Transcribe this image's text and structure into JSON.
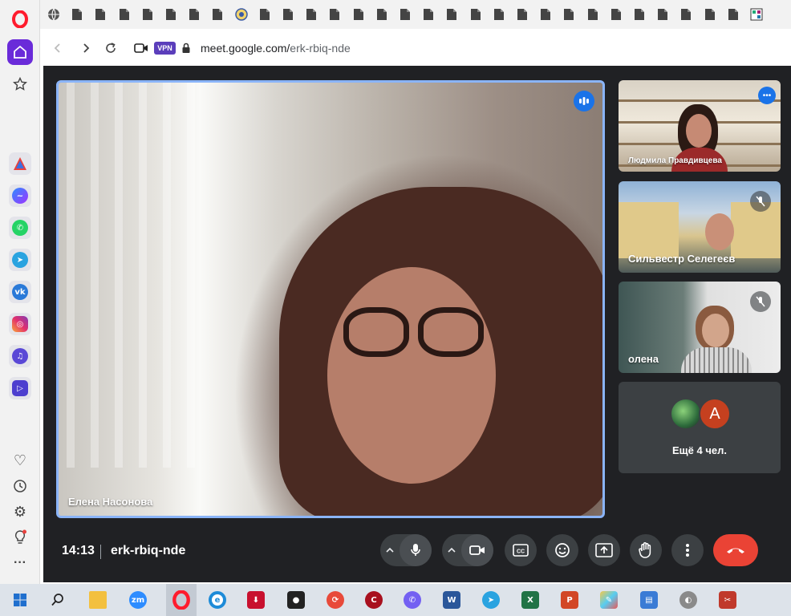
{
  "browser": {
    "url_host": "meet.google.com/",
    "url_path": "erk-rbiq-nde",
    "vpn_badge": "VPN",
    "tab_count": 31
  },
  "sidebar": {
    "apps": [
      "aria-icon",
      "messenger-icon",
      "whatsapp-icon",
      "telegram-icon",
      "vk-icon",
      "instagram-icon",
      "music-player-icon",
      "player-icon"
    ],
    "bottom": [
      "heart-icon",
      "history-icon",
      "settings-icon",
      "lightbulb-icon",
      "more-icon"
    ]
  },
  "meet": {
    "main_tile": {
      "name": "Елена Насонова"
    },
    "participants": [
      {
        "name": "Людмила Правдивцева",
        "muted": false
      },
      {
        "name": "Сильвестр Селегеєв",
        "muted": true
      },
      {
        "name": "олена",
        "muted": true
      }
    ],
    "more": {
      "label": "Ещё 4 чел.",
      "avatar_letter": "A",
      "avatar_color": "#c5401f"
    },
    "time": "14:13",
    "code": "erk-rbiq-nde"
  },
  "colors": {
    "accent": "#8ab4f8",
    "leave": "#ea4335",
    "vpn": "#5b3ebb",
    "opera_red": "#ff1b2d"
  }
}
